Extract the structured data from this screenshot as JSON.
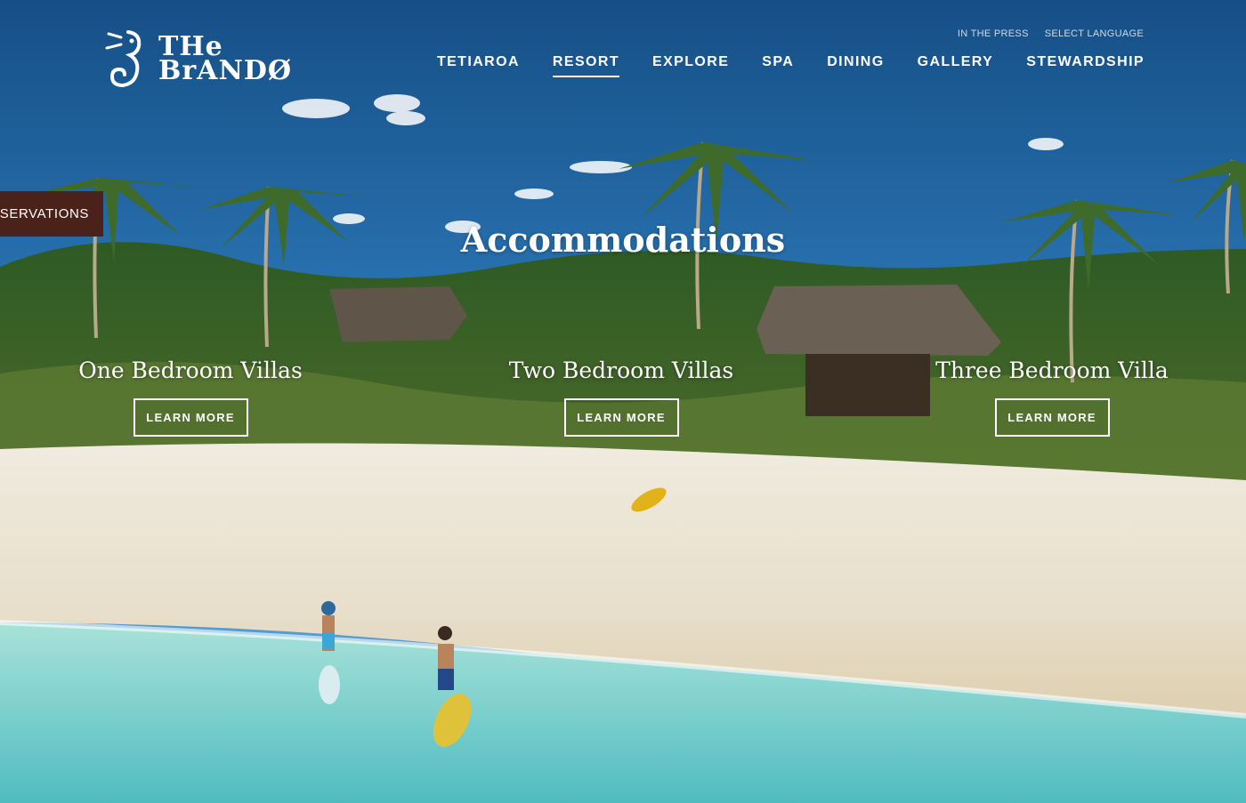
{
  "brand": {
    "logo_line1": "THe",
    "logo_line2": "BrANDØ"
  },
  "utility_nav": {
    "press": "IN THE PRESS",
    "language": "SELECT LANGUAGE"
  },
  "main_nav": [
    {
      "label": "TETIAROA",
      "active": false
    },
    {
      "label": "RESORT",
      "active": true
    },
    {
      "label": "EXPLORE",
      "active": false
    },
    {
      "label": "SPA",
      "active": false
    },
    {
      "label": "DINING",
      "active": false
    },
    {
      "label": "GALLERY",
      "active": false
    },
    {
      "label": "STEWARDSHIP",
      "active": false
    }
  ],
  "reservations_tab": "ESERVATIONS",
  "page_title": "Accommodations",
  "villas": [
    {
      "title": "One Bedroom Villas",
      "cta": "LEARN MORE"
    },
    {
      "title": "Two Bedroom Villas",
      "cta": "LEARN MORE"
    },
    {
      "title": "Three Bedroom Villa",
      "cta": "LEARN MORE"
    }
  ],
  "colors": {
    "reservations_bg": "#4b2219",
    "sky": "#2f7fc0",
    "lagoon": "#7fd3cc",
    "sand": "#e9e1cf"
  }
}
